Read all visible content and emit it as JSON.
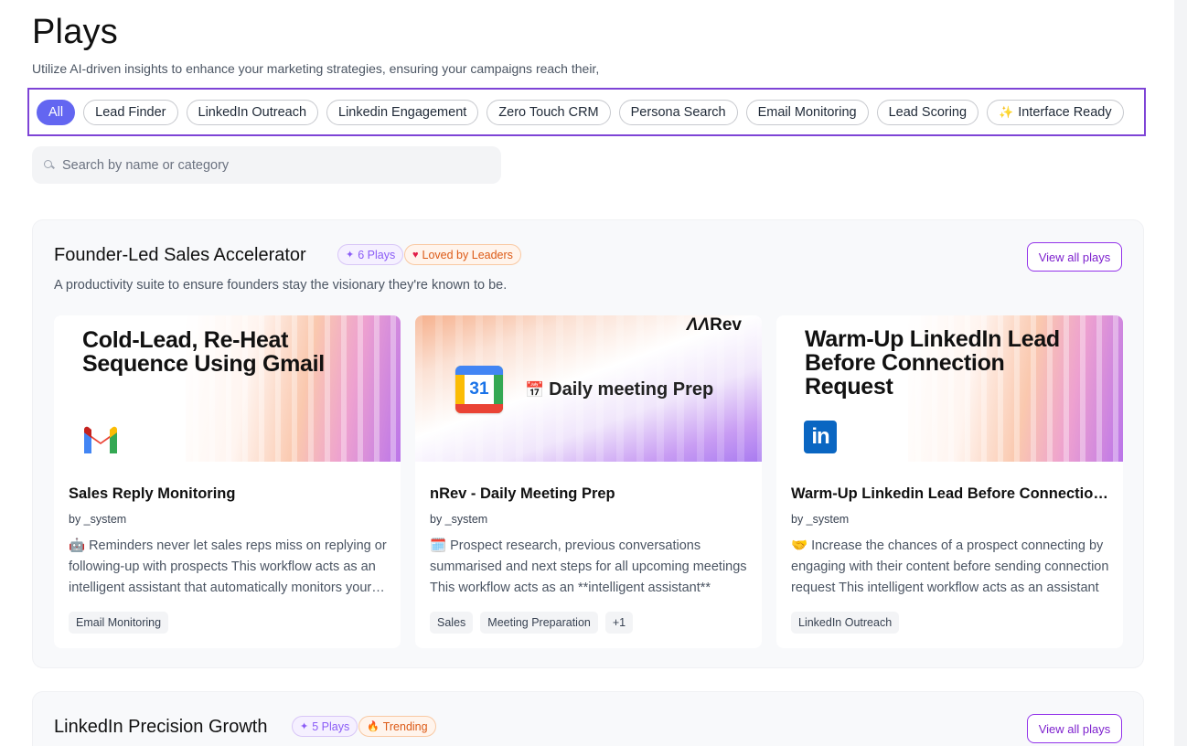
{
  "header": {
    "title": "Plays",
    "subtitle": "Utilize AI-driven insights to enhance your marketing strategies, ensuring your campaigns reach their,"
  },
  "filters": [
    {
      "label": "All",
      "active": true
    },
    {
      "label": "Lead Finder"
    },
    {
      "label": "LinkedIn Outreach"
    },
    {
      "label": "Linkedin Engagement"
    },
    {
      "label": "Zero Touch CRM"
    },
    {
      "label": "Persona Search"
    },
    {
      "label": "Email Monitoring"
    },
    {
      "label": "Lead Scoring"
    },
    {
      "label": "Interface Ready",
      "icon": "sparkle-icon"
    }
  ],
  "search": {
    "placeholder": "Search by name or category"
  },
  "sections": [
    {
      "title": "Founder-Led Sales Accelerator",
      "plays_badge": "6 Plays",
      "tag_badge": "Loved by Leaders",
      "view_all": "View all plays",
      "description": "A productivity suite to ensure founders stay the visionary they're known to be.",
      "cards": [
        {
          "thumb_text": "Cold-Lead, Re-Heat Sequence Using Gmail",
          "title": "Sales Reply Monitoring",
          "by": "by _system",
          "description": "🤖 Reminders never let sales reps miss on replying or following-up with prospects This workflow acts as an intelligent assistant that automatically monitors your inbox",
          "tags": [
            "Email Monitoring"
          ]
        },
        {
          "thumb_text": "Daily meeting Prep",
          "brand": "Rev",
          "calendar_day": "31",
          "title": "nRev - Daily Meeting Prep",
          "by": "by _system",
          "description": "🗓️ Prospect research, previous conversations summarised and next steps for all upcoming meetings This workflow acts as an **intelligent assistant**",
          "tags": [
            "Sales",
            "Meeting Preparation",
            "+1"
          ]
        },
        {
          "thumb_text": "Warm-Up LinkedIn Lead Before Connection Request",
          "title": "Warm-Up Linkedin Lead Before Connection Request",
          "by": "by _system",
          "description": "🤝 Increase the chances of a prospect connecting by engaging with their content before sending connection request This intelligent workflow acts as an assistant",
          "tags": [
            "LinkedIn Outreach"
          ]
        }
      ]
    },
    {
      "title": "LinkedIn Precision Growth",
      "plays_badge": "5 Plays",
      "tag_badge": "Trending",
      "view_all": "View all plays"
    }
  ],
  "colors": {
    "accent": "#6366f1",
    "highlight_border": "#7e44d6",
    "view_button": "#9333ea",
    "tag_orange": "#dc5a16"
  }
}
